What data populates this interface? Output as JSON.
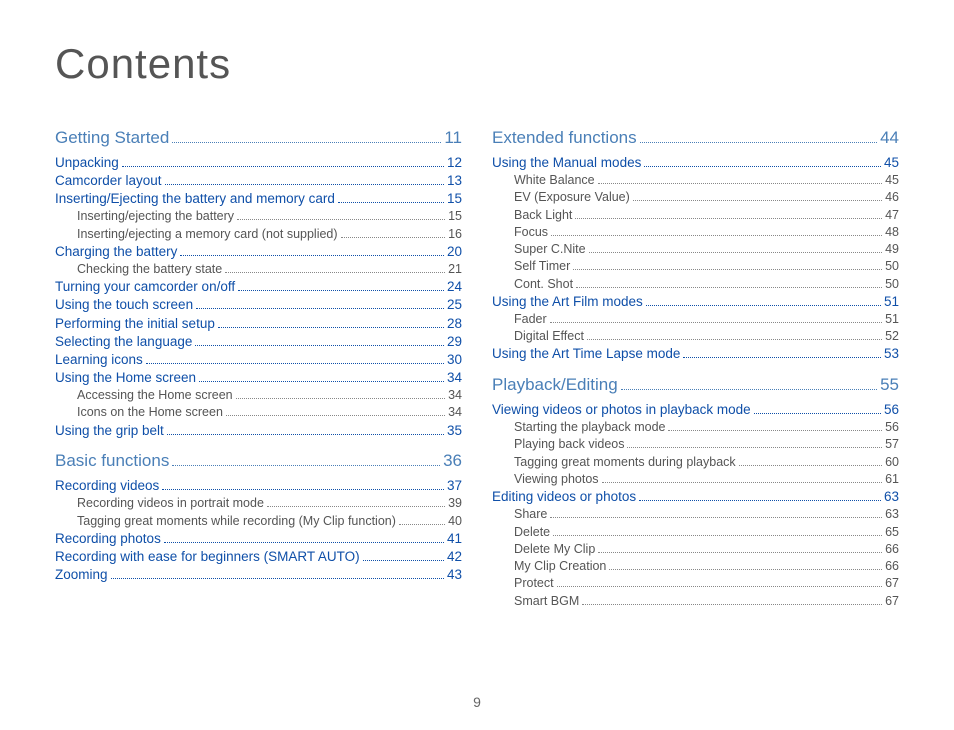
{
  "title": "Contents",
  "page_number": "9",
  "columns": [
    [
      {
        "level": 1,
        "label": "Getting Started",
        "page": "11"
      },
      {
        "level": 2,
        "label": "Unpacking",
        "page": "12"
      },
      {
        "level": 2,
        "label": "Camcorder layout",
        "page": "13"
      },
      {
        "level": 2,
        "label": "Inserting/Ejecting the battery and memory card",
        "page": "15"
      },
      {
        "level": 3,
        "label": "Inserting/ejecting the battery",
        "page": "15"
      },
      {
        "level": 3,
        "label": "Inserting/ejecting a memory card (not supplied)",
        "page": "16"
      },
      {
        "level": 2,
        "label": "Charging the battery",
        "page": "20"
      },
      {
        "level": 3,
        "label": "Checking the battery state",
        "page": "21"
      },
      {
        "level": 2,
        "label": "Turning your camcorder on/off",
        "page": "24"
      },
      {
        "level": 2,
        "label": "Using the touch screen",
        "page": "25"
      },
      {
        "level": 2,
        "label": "Performing the initial setup",
        "page": "28"
      },
      {
        "level": 2,
        "label": "Selecting the language",
        "page": "29"
      },
      {
        "level": 2,
        "label": "Learning icons",
        "page": "30"
      },
      {
        "level": 2,
        "label": "Using the Home screen",
        "page": "34"
      },
      {
        "level": 3,
        "label": "Accessing the Home screen",
        "page": "34"
      },
      {
        "level": 3,
        "label": "Icons on the Home screen",
        "page": "34"
      },
      {
        "level": 2,
        "label": "Using the grip belt",
        "page": "35"
      },
      {
        "level": 1,
        "label": "Basic functions",
        "page": "36"
      },
      {
        "level": 2,
        "label": "Recording videos",
        "page": "37"
      },
      {
        "level": 3,
        "label": "Recording videos in portrait mode",
        "page": "39"
      },
      {
        "level": 3,
        "label": "Tagging great moments while recording (My Clip function)",
        "page": "40"
      },
      {
        "level": 2,
        "label": "Recording photos",
        "page": "41"
      },
      {
        "level": 2,
        "label": "Recording with ease for beginners (SMART AUTO)",
        "page": "42"
      },
      {
        "level": 2,
        "label": "Zooming",
        "page": "43"
      }
    ],
    [
      {
        "level": 1,
        "label": "Extended functions",
        "page": "44"
      },
      {
        "level": 2,
        "label": "Using the Manual modes",
        "page": "45"
      },
      {
        "level": 3,
        "label": "White Balance",
        "page": "45"
      },
      {
        "level": 3,
        "label": "EV (Exposure Value)",
        "page": "46"
      },
      {
        "level": 3,
        "label": "Back Light",
        "page": "47"
      },
      {
        "level": 3,
        "label": "Focus",
        "page": "48"
      },
      {
        "level": 3,
        "label": "Super C.Nite",
        "page": "49"
      },
      {
        "level": 3,
        "label": "Self Timer",
        "page": "50"
      },
      {
        "level": 3,
        "label": "Cont. Shot",
        "page": "50"
      },
      {
        "level": 2,
        "label": "Using the Art Film modes",
        "page": "51"
      },
      {
        "level": 3,
        "label": "Fader",
        "page": "51"
      },
      {
        "level": 3,
        "label": "Digital Effect",
        "page": "52"
      },
      {
        "level": 2,
        "label": "Using the Art Time Lapse mode",
        "page": "53"
      },
      {
        "level": 1,
        "label": "Playback/Editing",
        "page": "55"
      },
      {
        "level": 2,
        "label": "Viewing videos or photos in playback mode",
        "page": "56"
      },
      {
        "level": 3,
        "label": "Starting the playback mode",
        "page": "56"
      },
      {
        "level": 3,
        "label": "Playing back videos",
        "page": "57"
      },
      {
        "level": 3,
        "label": "Tagging great moments during playback",
        "page": "60"
      },
      {
        "level": 3,
        "label": "Viewing photos",
        "page": "61"
      },
      {
        "level": 2,
        "label": "Editing videos or photos",
        "page": "63"
      },
      {
        "level": 3,
        "label": "Share",
        "page": "63"
      },
      {
        "level": 3,
        "label": "Delete",
        "page": "65"
      },
      {
        "level": 3,
        "label": "Delete My Clip",
        "page": "66"
      },
      {
        "level": 3,
        "label": "My Clip Creation",
        "page": "66"
      },
      {
        "level": 3,
        "label": "Protect",
        "page": "67"
      },
      {
        "level": 3,
        "label": "Smart BGM",
        "page": "67"
      }
    ]
  ]
}
